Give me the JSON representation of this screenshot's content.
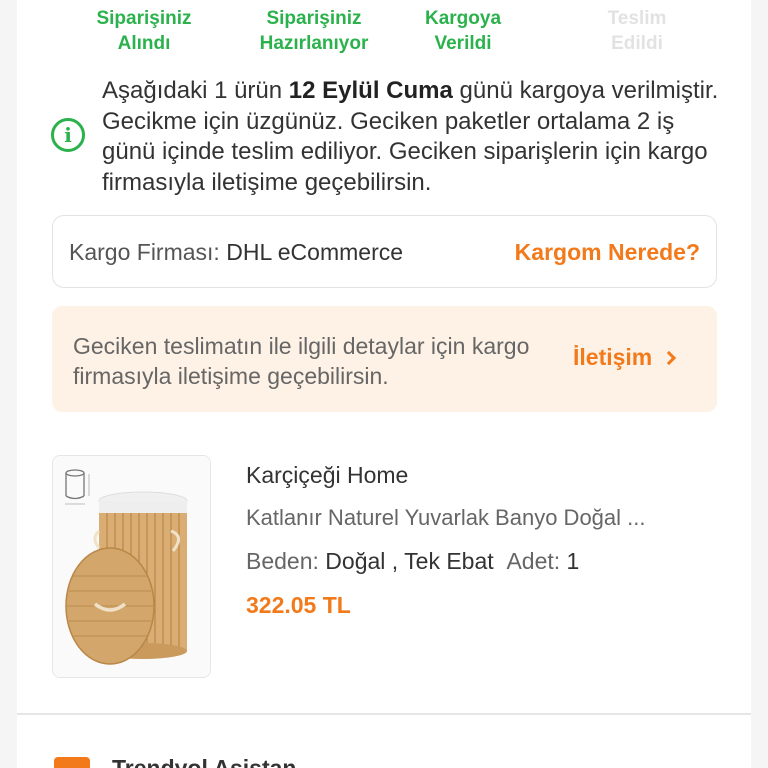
{
  "status_steps": [
    {
      "line1": "Siparişiniz",
      "line2": "Alındı",
      "state": "done"
    },
    {
      "line1": "Siparişiniz",
      "line2": "Hazırlanıyor",
      "state": "done"
    },
    {
      "line1": "Kargoya",
      "line2": "Verildi",
      "state": "done"
    },
    {
      "line1": "Teslim",
      "line2": "Edildi",
      "state": "pending"
    }
  ],
  "info": {
    "icon": "info-circle-icon",
    "text_before": "Aşağıdaki 1 ürün ",
    "date_bold": "12 Eylül Cuma",
    "text_after": " günü kargoya verilmiştir. Gecikme için üzgünüz. Geciken paketler ortalama 2 iş günü içinde teslim ediliyor. Geciken siparişlerin için kargo firmasıyla iletişime geçebilirsin."
  },
  "cargo": {
    "label": "Kargo Firması:",
    "company": "DHL eCommerce",
    "link": "Kargom Nerede?"
  },
  "notice": {
    "text": "Geciken teslimatın ile ilgili detaylar için kargo firmasıyla iletişime geçebilirsin.",
    "link": "İletişim"
  },
  "product": {
    "brand": "Karçiçeği Home",
    "title": "Katlanır Naturel Yuvarlak Banyo Doğal ...",
    "size_label": "Beden:",
    "size_value": "Doğal , Tek Ebat",
    "qty_label": "Adet:",
    "qty_value": "1",
    "price": "322.05 TL"
  },
  "assistant": {
    "label": "Trendyol Asistan"
  },
  "colors": {
    "green": "#2bb24c",
    "orange": "#f27a1a",
    "notice_bg": "#fef2e6"
  }
}
